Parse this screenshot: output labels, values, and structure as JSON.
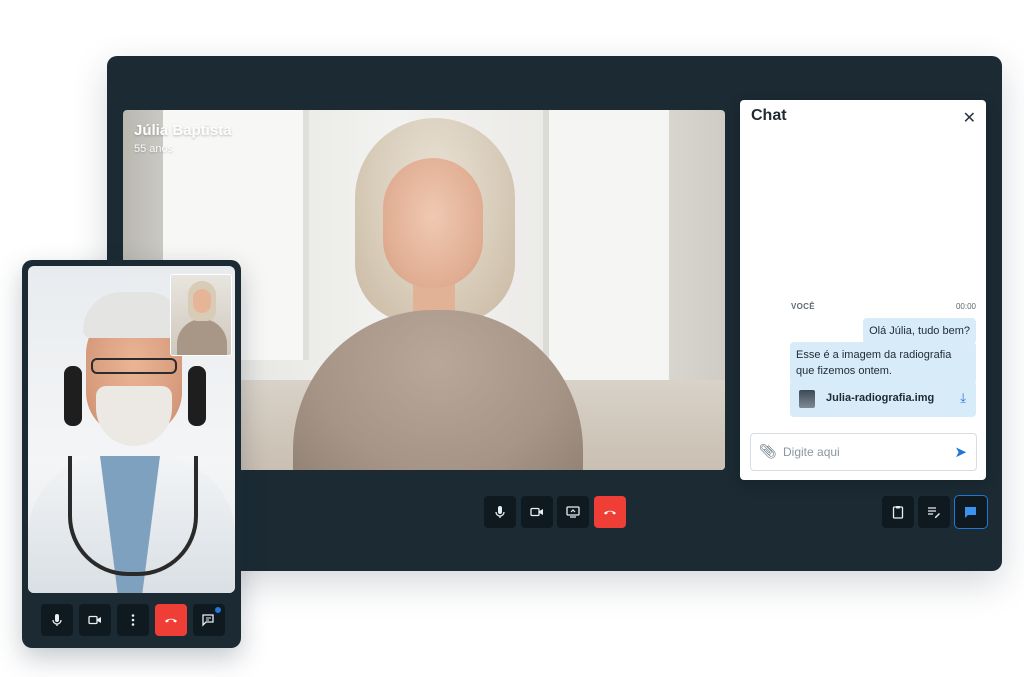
{
  "caller": {
    "name": "Júlia Baptista",
    "age": "55 anos"
  },
  "controls": {
    "mic_icon": "microphone-icon",
    "camera_icon": "video-camera-icon",
    "screen_icon": "screen-share-icon",
    "end_icon": "phone-hangup-icon",
    "clipboard_icon": "clipboard-icon",
    "notes_icon": "notes-edit-icon",
    "chat_icon": "chat-icon",
    "more_icon": "more-vertical-icon"
  },
  "chat": {
    "title": "Chat",
    "close_symbol": "✕",
    "sender": "VOCÊ",
    "time": "00:00",
    "messages": [
      "Olá Júlia, tudo bem?",
      "Esse é a imagem da radiografia que fizemos ontem."
    ],
    "attachment": {
      "name": "Julia-radiografia.img"
    },
    "input_placeholder": "Digite aqui"
  },
  "colors": {
    "panel": "#1b2a33",
    "end_call": "#ef3e36",
    "accent": "#1e78d4",
    "bubble": "#d8ebf9"
  }
}
